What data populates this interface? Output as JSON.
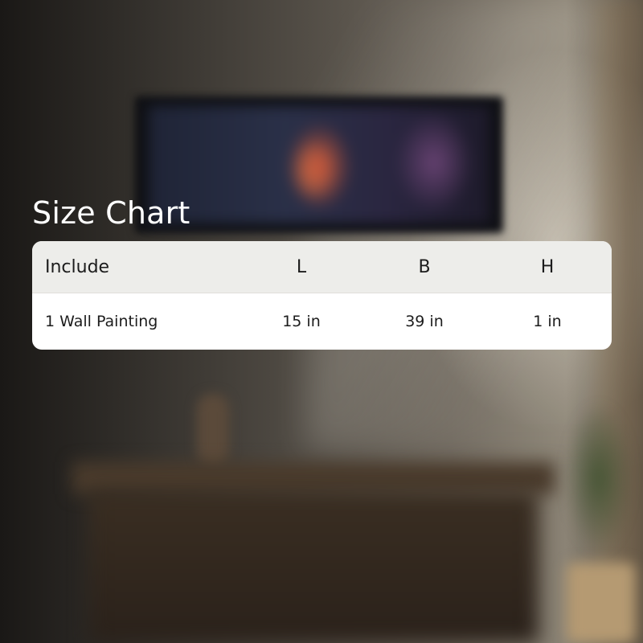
{
  "title": "Size Chart",
  "size_table": {
    "headers": [
      "Include",
      "L",
      "B",
      "H"
    ],
    "rows": [
      [
        "1 Wall Painting",
        "15 in",
        "39 in",
        "1 in"
      ]
    ]
  }
}
